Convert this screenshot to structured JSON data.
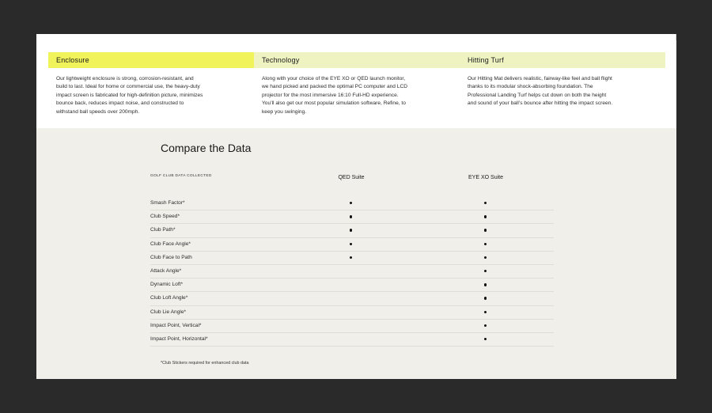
{
  "colors": {
    "page_background": "#2a2a2a",
    "card_background": "#ffffff",
    "active_tab": "#f0f45a",
    "inactive_tab": "#eff3c2",
    "compare_background": "#f1efea"
  },
  "tabs": [
    {
      "label": "Enclosure",
      "active": true
    },
    {
      "label": "Technology",
      "active": false
    },
    {
      "label": "Hitting Turf",
      "active": false
    }
  ],
  "descriptions": [
    "Our lightweight enclosure is strong, corrosion-resistant, and build to last. Ideal for home or commercial use, the heavy-duty impact screen is fabricated for high-definition picture, minimizes bounce back, reduces impact noise, and constructed to withstand ball speeds over 200mph.",
    "Along with your choice of the EYE XO or QED launch monitor, we hand picked and packed the optimal PC computer and LCD projector for the most immersive 16:10 Full-HD experience. You’ll also get our most popular simulation software, Refine, to keep you swinging.",
    "Our Hitting Mat delivers realistic, fairway-like feel and ball flight thanks to its modular shock-absorbing foundation. The Professional Landing Turf helps cut down on both the height and sound of your ball’s bounce after hitting the impact screen."
  ],
  "compare": {
    "title": "Compare the Data",
    "column_caption": "GOLF CLUB DATA COLLECTED",
    "columns": [
      "QED Suite",
      "EYE XO Suite"
    ],
    "rows": [
      {
        "label": "Smash Factor*",
        "qed": true,
        "eyexo": true
      },
      {
        "label": "Club Speed*",
        "qed": true,
        "eyexo": true
      },
      {
        "label": "Club Path*",
        "qed": true,
        "eyexo": true
      },
      {
        "label": "Club Face Angle*",
        "qed": true,
        "eyexo": true
      },
      {
        "label": "Club Face to Path",
        "qed": true,
        "eyexo": true
      },
      {
        "label": "Attack Angle*",
        "qed": false,
        "eyexo": true
      },
      {
        "label": "Dynamic Loft*",
        "qed": false,
        "eyexo": true
      },
      {
        "label": "Club Loft Angle*",
        "qed": false,
        "eyexo": true
      },
      {
        "label": "Club Lie Angle*",
        "qed": false,
        "eyexo": true
      },
      {
        "label": "Impact Point, Vertical*",
        "qed": false,
        "eyexo": true
      },
      {
        "label": "Impact Point, Horizontal*",
        "qed": false,
        "eyexo": true
      }
    ],
    "footnote": "*Club Stickers required for enhanced club data"
  }
}
